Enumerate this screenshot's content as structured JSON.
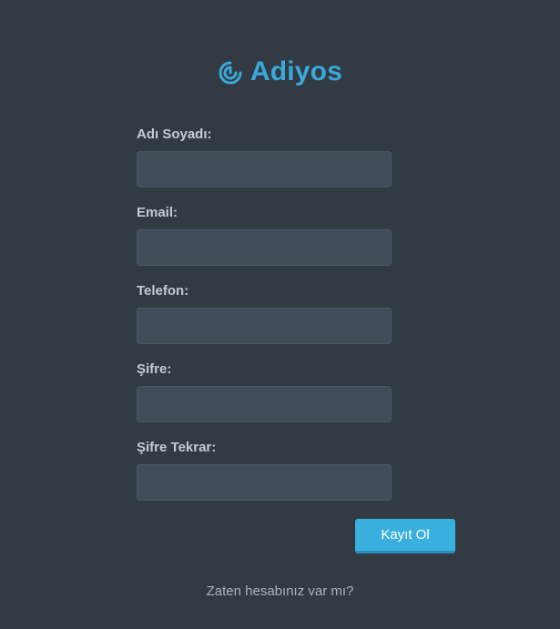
{
  "brand": {
    "name": "Adiyos",
    "icon": "spiral-logo-icon",
    "color": "#3aa9d9"
  },
  "form": {
    "fields": [
      {
        "label": "Adı Soyadı:",
        "value": "",
        "placeholder": ""
      },
      {
        "label": "Email:",
        "value": "",
        "placeholder": ""
      },
      {
        "label": "Telefon:",
        "value": "",
        "placeholder": ""
      },
      {
        "label": "Şifre:",
        "value": "",
        "placeholder": ""
      },
      {
        "label": "Şifre Tekrar:",
        "value": "",
        "placeholder": ""
      }
    ],
    "submit_label": "Kayıt Ol"
  },
  "footer": {
    "login_link": "Zaten hesabınız var mı?"
  },
  "colors": {
    "background": "#323a44",
    "input_background": "#414c58",
    "accent": "#3ab0df"
  }
}
